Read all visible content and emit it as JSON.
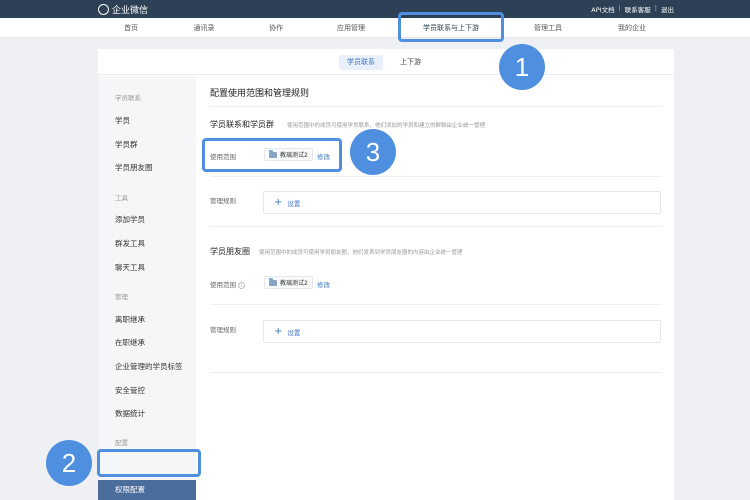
{
  "topbar": {
    "logo_text": "企业微信",
    "links": [
      "API文档",
      "联系客服",
      "退出"
    ]
  },
  "mainnav": {
    "items": [
      "首页",
      "通讯录",
      "协作",
      "应用管理",
      "学员联系与上下游",
      "管理工具",
      "我的企业"
    ],
    "active_index": 4
  },
  "subtabs": {
    "items": [
      "学员联系",
      "上下游"
    ],
    "active_index": 0
  },
  "sidebar": {
    "groups": [
      {
        "label": "学员联系",
        "items": [
          "学员",
          "学员群",
          "学员朋友圈"
        ]
      },
      {
        "label": "工具",
        "items": [
          "添加学员",
          "群发工具",
          "聊天工具"
        ]
      },
      {
        "label": "管理",
        "items": [
          "离职继承",
          "在职继承",
          "企业管理的学员标签",
          "安全管控",
          "数据统计"
        ]
      },
      {
        "label": "配置",
        "items": [
          "权限配置"
        ]
      }
    ],
    "active_item": "权限配置"
  },
  "content": {
    "title": "配置使用范围和管理规则",
    "sections": [
      {
        "title": "学员联系和学员群",
        "desc": "使用范围中的成员可使用学员联系，他们添加的学员和建立的群聊由企业统一管理",
        "scope_label": "使用范围",
        "scope_value": "教璃测试2",
        "edit_label": "修改",
        "rules_label": "管理规则",
        "setting_label": "设置"
      },
      {
        "title": "学员朋友圈",
        "desc": "使用范围中的成员可使用学员朋友圈，他们发表到学员朋友圈的内容由企业统一管理",
        "scope_label": "使用范围",
        "scope_value": "教璃测试2",
        "edit_label": "修改",
        "rules_label": "管理规则",
        "setting_label": "设置"
      }
    ]
  },
  "callouts": {
    "badge_1": "1",
    "badge_2": "2",
    "badge_3": "3",
    "color": "#4f8fe0"
  },
  "colors": {
    "topbar": "#2d4055",
    "accent": "#3c77c6",
    "sidebar_active": "#4a6d9b"
  }
}
